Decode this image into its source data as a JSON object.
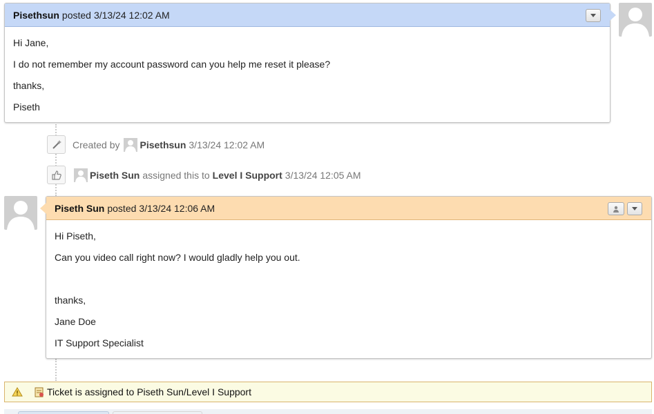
{
  "thread": {
    "post1": {
      "author": "Pisethsun",
      "posted": "posted",
      "date": "3/13/24 12:02 AM",
      "lines": [
        "Hi Jane,",
        "I do not remember my account password can you help me reset it please?",
        "thanks,",
        "Piseth"
      ],
      "header_color": "#c5d8f7"
    },
    "event1": {
      "prefix": "Created by",
      "user": "Pisethsun",
      "date": "3/13/24 12:02 AM"
    },
    "event2": {
      "user": "Piseth Sun",
      "middle": "assigned this to",
      "target": "Level I Support",
      "date": "3/13/24 12:05 AM"
    },
    "post2": {
      "author": "Piseth Sun",
      "posted": "posted",
      "date": "3/13/24 12:06 AM",
      "lines": [
        "Hi Piseth,",
        "Can you video call right now? I would gladly help you out.",
        "",
        "thanks,",
        "Jane Doe",
        "IT Support Specialist"
      ],
      "header_color": "#fddcb0"
    }
  },
  "notice": {
    "text": "Ticket is assigned to Piseth Sun/Level I Support",
    "background": "#fbfbe3",
    "border": "#d9b36b"
  },
  "icons": {
    "menu_dropdown": "chevron-down-icon",
    "person": "person-icon",
    "created": "magic-wand-icon",
    "assigned": "thumbs-up-icon",
    "warning": "warning-icon",
    "ticket": "ticket-icon"
  }
}
